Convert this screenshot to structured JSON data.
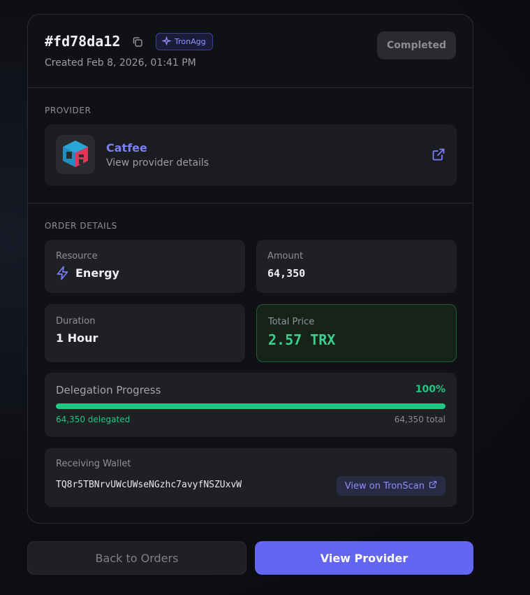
{
  "order": {
    "id": "#fd78da12",
    "tag": "TronAgg",
    "created": "Created Feb 8, 2026, 01:41 PM",
    "status": "Completed"
  },
  "provider": {
    "section_label": "PROVIDER",
    "name": "Catfee",
    "subtitle": "View provider details"
  },
  "details": {
    "section_label": "ORDER DETAILS",
    "resource_label": "Resource",
    "resource_value": "Energy",
    "amount_label": "Amount",
    "amount_value": "64,350",
    "duration_label": "Duration",
    "duration_value": "1 Hour",
    "price_label": "Total Price",
    "price_value": "2.57 TRX"
  },
  "progress": {
    "label": "Delegation Progress",
    "percent_text": "100%",
    "fraction": 1.0,
    "delegated_text": "64,350 delegated",
    "total_text": "64,350 total"
  },
  "wallet": {
    "label": "Receiving Wallet",
    "address": "TQ8r5TBNrvUWcUWseNGzhc7avyfNSZUxvW",
    "tronscan_label": "View on TronScan"
  },
  "actions": {
    "back_label": "Back to Orders",
    "view_provider_label": "View Provider"
  },
  "colors": {
    "accent": "#6366f1",
    "success": "#1ec782",
    "status_bg": "#2a2b30"
  }
}
